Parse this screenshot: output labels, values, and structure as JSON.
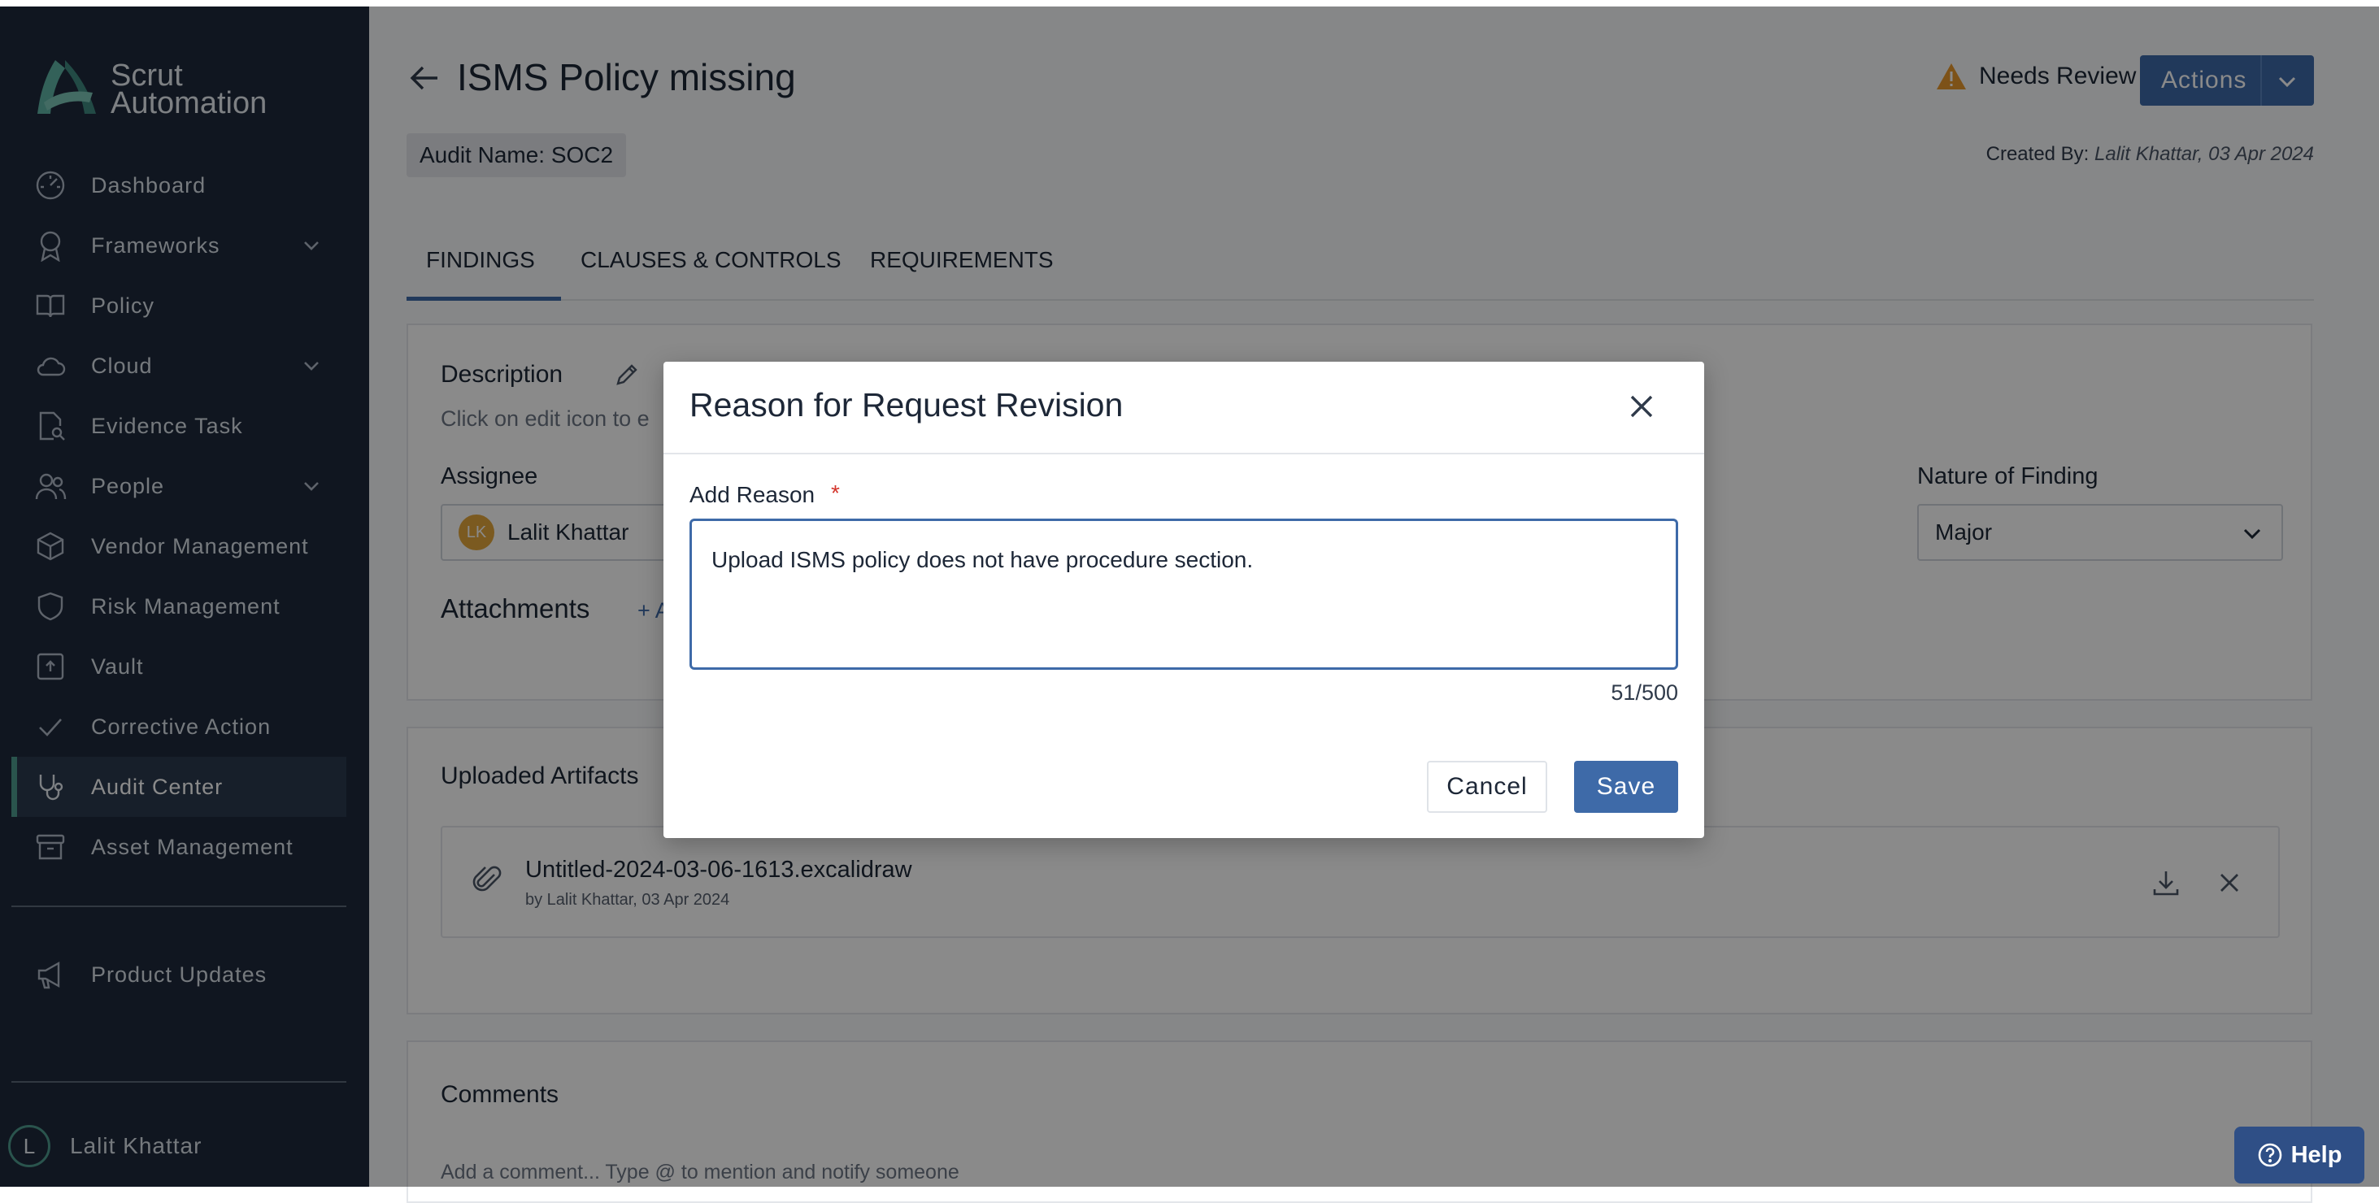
{
  "app": {
    "brand_line1": "Scrut",
    "brand_line2": "Automation"
  },
  "sidebar": {
    "items": [
      {
        "label": "Dashboard",
        "icon": "dashboard-icon"
      },
      {
        "label": "Frameworks",
        "icon": "award-icon",
        "expandable": true
      },
      {
        "label": "Policy",
        "icon": "book-icon"
      },
      {
        "label": "Cloud",
        "icon": "cloud-icon",
        "expandable": true
      },
      {
        "label": "Evidence Task",
        "icon": "file-search-icon"
      },
      {
        "label": "People",
        "icon": "people-icon",
        "expandable": true
      },
      {
        "label": "Vendor Management",
        "icon": "box-icon"
      },
      {
        "label": "Risk Management",
        "icon": "shield-icon"
      },
      {
        "label": "Vault",
        "icon": "vault-icon"
      },
      {
        "label": "Corrective Action",
        "icon": "check-icon"
      },
      {
        "label": "Audit Center",
        "icon": "stethoscope-icon",
        "active": true
      },
      {
        "label": "Asset Management",
        "icon": "archive-icon"
      }
    ],
    "product_updates": "Product Updates",
    "user": {
      "initial": "L",
      "name": "Lalit Khattar"
    }
  },
  "header": {
    "title": "ISMS Policy missing",
    "status": "Needs Review",
    "actions_label": "Actions",
    "audit_name": "Audit Name: SOC2",
    "created_by_label": "Created By:",
    "created_by_value": "Lalit Khattar, 03 Apr 2024"
  },
  "tabs": [
    "FINDINGS",
    "CLAUSES & CONTROLS",
    "REQUIREMENTS"
  ],
  "details": {
    "description_title": "Description",
    "description_hint": "Click on edit icon to e",
    "assignee_label": "Assignee",
    "assignee_initials": "LK",
    "assignee_name": "Lalit Khattar",
    "nature_label": "Nature of Finding",
    "nature_value": "Major",
    "attachments_title": "Attachments",
    "add_attachment": "+ A"
  },
  "artifacts": {
    "title": "Uploaded Artifacts",
    "file_name": "Untitled-2024-03-06-1613.excalidraw",
    "file_meta": "by Lalit Khattar, 03 Apr 2024"
  },
  "comments": {
    "title": "Comments",
    "placeholder": "Add a comment... Type @ to mention and notify someone"
  },
  "modal": {
    "title": "Reason for Request Revision",
    "field_label": "Add Reason",
    "required_mark": "*",
    "value": "Upload ISMS policy does not have procedure section.",
    "char_count": "51/500",
    "cancel": "Cancel",
    "save": "Save"
  },
  "help": {
    "label": "Help"
  },
  "colors": {
    "sidebar_bg": "#1e2a3c",
    "accent": "#3e6aa8",
    "brand_teal": "#4f9b8f",
    "warning": "#e8982e",
    "required": "#d3342b"
  }
}
